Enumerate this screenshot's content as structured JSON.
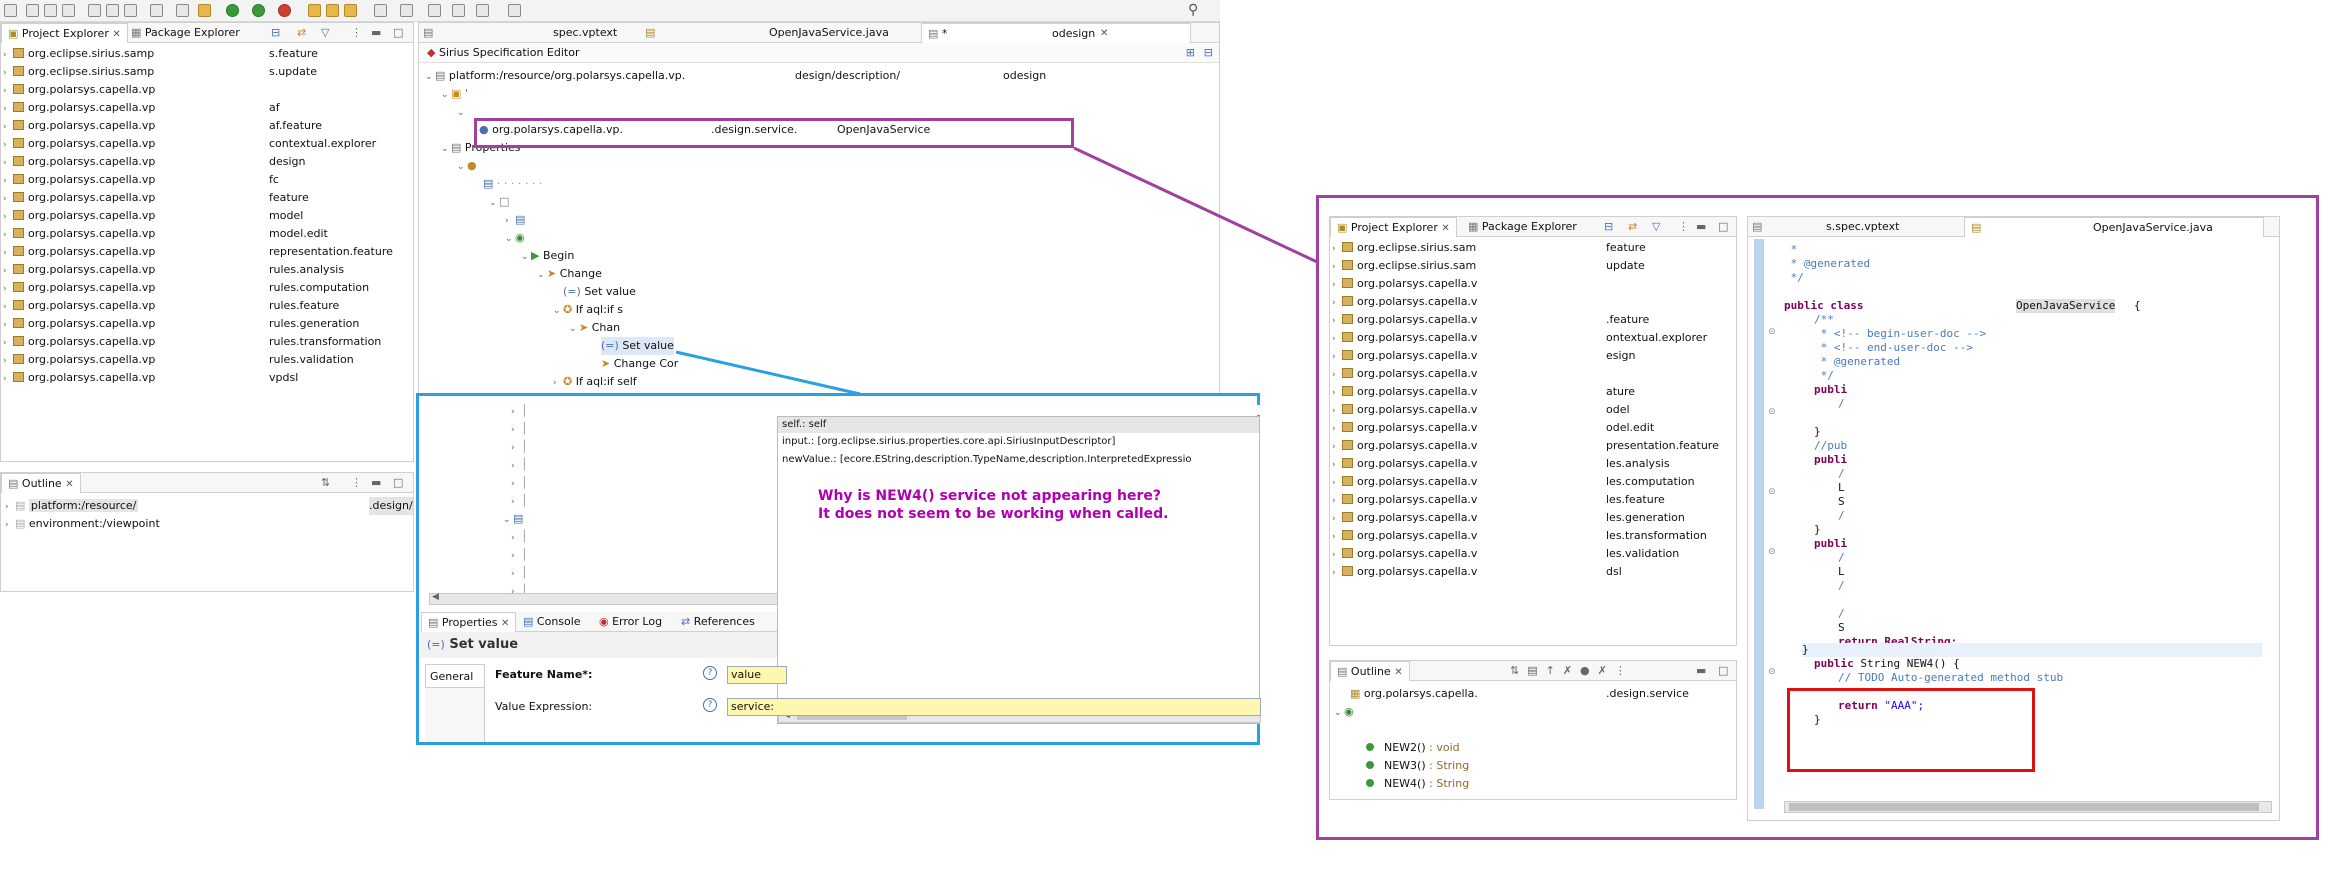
{
  "left_views": {
    "project_explorer_tab": "Project Explorer",
    "package_explorer_tab": "Package Explorer",
    "projects": [
      {
        "name": "org.eclipse.sirius.samp",
        "suffix": "s.feature"
      },
      {
        "name": "org.eclipse.sirius.samp",
        "suffix": "s.update"
      },
      {
        "name": "org.polarsys.capella.vp",
        "suffix": ""
      },
      {
        "name": "org.polarsys.capella.vp",
        "suffix": "af"
      },
      {
        "name": "org.polarsys.capella.vp",
        "suffix": "af.feature"
      },
      {
        "name": "org.polarsys.capella.vp",
        "suffix": "contextual.explorer"
      },
      {
        "name": "org.polarsys.capella.vp",
        "suffix": "design"
      },
      {
        "name": "org.polarsys.capella.vp",
        "suffix": "fc"
      },
      {
        "name": "org.polarsys.capella.vp",
        "suffix": "feature"
      },
      {
        "name": "org.polarsys.capella.vp",
        "suffix": "model"
      },
      {
        "name": "org.polarsys.capella.vp",
        "suffix": "model.edit"
      },
      {
        "name": "org.polarsys.capella.vp",
        "suffix": "representation.feature"
      },
      {
        "name": "org.polarsys.capella.vp",
        "suffix": "rules.analysis"
      },
      {
        "name": "org.polarsys.capella.vp",
        "suffix": "rules.computation"
      },
      {
        "name": "org.polarsys.capella.vp",
        "suffix": "rules.feature"
      },
      {
        "name": "org.polarsys.capella.vp",
        "suffix": "rules.generation"
      },
      {
        "name": "org.polarsys.capella.vp",
        "suffix": "rules.transformation"
      },
      {
        "name": "org.polarsys.capella.vp",
        "suffix": "rules.validation"
      },
      {
        "name": "org.polarsys.capella.vp",
        "suffix": "vpdsl"
      }
    ],
    "outline_tab": "Outline",
    "outline_items": [
      "platform:/resource/",
      ".design/",
      "environment:/viewpoint"
    ]
  },
  "editor": {
    "tabs": [
      "spec.vptext",
      "OpenJavaService.java",
      "*",
      "odesign"
    ],
    "title": "Sirius Specification Editor",
    "root_path": "platform:/resource/org.polarsys.capella.vp.",
    "root_path_suffix1": "design/description/",
    "root_path_suffix2": "odesign",
    "java_extension": {
      "prefix": "org.polarsys.capella.vp.",
      "mid": ".design.service.",
      "class": "OpenJavaService"
    },
    "properties_node": "Properties",
    "nodes": {
      "begin": "Begin",
      "change": "Change",
      "set_value": "Set value",
      "if": "If aql:if s",
      "chan": "Chan",
      "set_value2": "Set value",
      "change_con": "Change Cor",
      "if2": "If aql:if self"
    }
  },
  "bottom_views": {
    "tabs": [
      "Properties",
      "Console",
      "Error Log",
      "References"
    ],
    "section_title": "Set value",
    "tab_general": "General",
    "feature_name_label": "Feature Name*:",
    "feature_name_value": "value",
    "value_expression_label": "Value Expression:",
    "value_expression_value": "service:"
  },
  "completion": {
    "items": [
      "self.: self",
      "input.: [org.eclipse.sirius.properties.core.api.SiriusInputDescriptor]",
      "newValue.: [ecore.EString,description.TypeName,description.InterpretedExpressio"
    ]
  },
  "annotation": {
    "line1": "Why is NEW4() service not appearing here?",
    "line2": "It does not seem to be working when called."
  },
  "right": {
    "project_explorer_tab": "Project Explorer",
    "package_explorer_tab": "Package Explorer",
    "projects": [
      {
        "name": "org.eclipse.sirius.sam",
        "suffix": "feature"
      },
      {
        "name": "org.eclipse.sirius.sam",
        "suffix": "update"
      },
      {
        "name": "org.polarsys.capella.v",
        "suffix": ""
      },
      {
        "name": "org.polarsys.capella.v",
        "suffix": ""
      },
      {
        "name": "org.polarsys.capella.v",
        "suffix": ".feature"
      },
      {
        "name": "org.polarsys.capella.v",
        "suffix": "ontextual.explorer"
      },
      {
        "name": "org.polarsys.capella.v",
        "suffix": "esign"
      },
      {
        "name": "org.polarsys.capella.v",
        "suffix": ""
      },
      {
        "name": "org.polarsys.capella.v",
        "suffix": "ature"
      },
      {
        "name": "org.polarsys.capella.v",
        "suffix": "odel"
      },
      {
        "name": "org.polarsys.capella.v",
        "suffix": "odel.edit"
      },
      {
        "name": "org.polarsys.capella.v",
        "suffix": "presentation.feature"
      },
      {
        "name": "org.polarsys.capella.v",
        "suffix": "les.analysis"
      },
      {
        "name": "org.polarsys.capella.v",
        "suffix": "les.computation"
      },
      {
        "name": "org.polarsys.capella.v",
        "suffix": "les.feature"
      },
      {
        "name": "org.polarsys.capella.v",
        "suffix": "les.generation"
      },
      {
        "name": "org.polarsys.capella.v",
        "suffix": "les.transformation"
      },
      {
        "name": "org.polarsys.capella.v",
        "suffix": "les.validation"
      },
      {
        "name": "org.polarsys.capella.v",
        "suffix": "dsl"
      }
    ],
    "outline_tab": "Outline",
    "outline_pkg": "org.polarsys.capella.",
    "outline_pkg_suffix": ".design.service",
    "methods": [
      {
        "name": "NEW2()",
        "type": ": void"
      },
      {
        "name": "NEW3()",
        "type": ": String"
      },
      {
        "name": "NEW4()",
        "type": ": String"
      }
    ],
    "editor_tabs": [
      "s.spec.vptext",
      "OpenJavaService.java"
    ],
    "code": {
      "l1": " *",
      "l2": " * @generated",
      "l3": " */",
      "class_kw": "public class",
      "class_name": "OpenJavaService",
      "brace": "{",
      "c1": "/**",
      "c2": " * <!-- begin-user-doc -->",
      "c3": " * <!-- end-user-doc -->",
      "c4": " * @generated",
      "c5": " */",
      "publ": "publi",
      "slash": "/",
      "close": "}",
      "pub_comment": "//pub",
      "l_char": "L",
      "s_char": "S",
      "return_tail": "return RealString;",
      "m_sig_kw": "public",
      "m_sig": "String NEW4() {",
      "todo": "// TODO Auto-generated method stub",
      "ret_kw": "return",
      "ret_val": "\"AAA\";",
      "end": "}"
    }
  }
}
